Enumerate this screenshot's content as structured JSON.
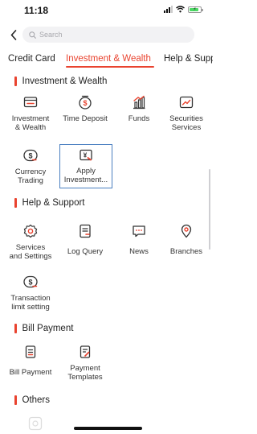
{
  "status": {
    "time": "11:18"
  },
  "search": {
    "placeholder": "Search"
  },
  "tabs": [
    {
      "label": "Credit Card",
      "active": false
    },
    {
      "label": "Investment & Wealth",
      "active": true
    },
    {
      "label": "Help & Supp",
      "active": false
    }
  ],
  "sections": {
    "investment": {
      "title": "Investment & Wealth",
      "items": [
        {
          "line1": "Investment",
          "line2": "& Wealth",
          "icon": "wallet-icon"
        },
        {
          "line1": "Time Deposit",
          "line2": "",
          "icon": "clock-dollar-icon"
        },
        {
          "line1": "Funds",
          "line2": "",
          "icon": "bar-chart-icon"
        },
        {
          "line1": "Securities",
          "line2": "Services",
          "icon": "trend-line-icon"
        },
        {
          "line1": "Currency",
          "line2": "Trading",
          "icon": "currency-exchange-icon"
        },
        {
          "line1": "Apply",
          "line2": "Investment...",
          "icon": "yen-card-icon"
        }
      ]
    },
    "help": {
      "title": "Help & Support",
      "items": [
        {
          "line1": "Services",
          "line2": "and Settings",
          "icon": "gear-icon"
        },
        {
          "line1": "Log Query",
          "line2": "",
          "icon": "document-icon"
        },
        {
          "line1": "News",
          "line2": "",
          "icon": "chat-icon"
        },
        {
          "line1": "Branches",
          "line2": "",
          "icon": "location-pin-icon"
        },
        {
          "line1": "Transaction",
          "line2": "limit setting",
          "icon": "limit-coin-icon"
        }
      ]
    },
    "bill": {
      "title": "Bill Payment",
      "items": [
        {
          "line1": "Bill Payment",
          "line2": "",
          "icon": "bill-icon"
        },
        {
          "line1": "Payment",
          "line2": "Templates",
          "icon": "template-icon"
        }
      ]
    },
    "others": {
      "title": "Others"
    }
  },
  "colors": {
    "accent": "#e9432f",
    "selection": "#4a7fc0",
    "text": "#222222"
  }
}
